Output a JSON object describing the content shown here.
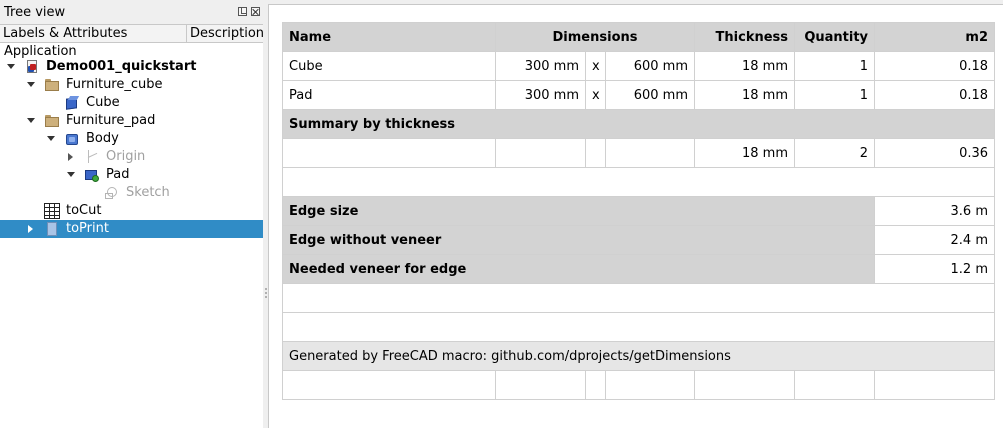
{
  "tree_view": {
    "title": "Tree view",
    "columns": {
      "labels": "Labels & Attributes",
      "description": "Description"
    },
    "items": [
      {
        "label": "Application"
      },
      {
        "label": "Demo001_quickstart"
      },
      {
        "label": "Furniture_cube"
      },
      {
        "label": "Cube"
      },
      {
        "label": "Furniture_pad"
      },
      {
        "label": "Body"
      },
      {
        "label": "Origin"
      },
      {
        "label": "Pad"
      },
      {
        "label": "Sketch"
      },
      {
        "label": "toCut"
      },
      {
        "label": "toPrint"
      }
    ]
  },
  "spreadsheet": {
    "headers": {
      "name": "Name",
      "dimensions": "Dimensions",
      "thickness": "Thickness",
      "quantity": "Quantity",
      "m2": "m2"
    },
    "rows": [
      {
        "name": "Cube",
        "dim1": "300 mm",
        "x": "x",
        "dim2": "600 mm",
        "thickness": "18 mm",
        "quantity": "1",
        "m2": "0.18"
      },
      {
        "name": "Pad",
        "dim1": "300 mm",
        "x": "x",
        "dim2": "600 mm",
        "thickness": "18 mm",
        "quantity": "1",
        "m2": "0.18"
      }
    ],
    "summary_label": "Summary by thickness",
    "summary_row": {
      "thickness": "18 mm",
      "quantity": "2",
      "m2": "0.36"
    },
    "edge": [
      {
        "label": "Edge size",
        "value": "3.6 m"
      },
      {
        "label": "Edge without veneer",
        "value": "2.4 m"
      },
      {
        "label": "Needed veneer for edge",
        "value": "1.2 m"
      }
    ],
    "footer_note": "Generated by FreeCAD macro: github.com/dprojects/getDimensions"
  },
  "colors": {
    "selection": "#308cc6",
    "header_fill": "#d3d3d3",
    "note_fill": "#e6e6e6"
  }
}
